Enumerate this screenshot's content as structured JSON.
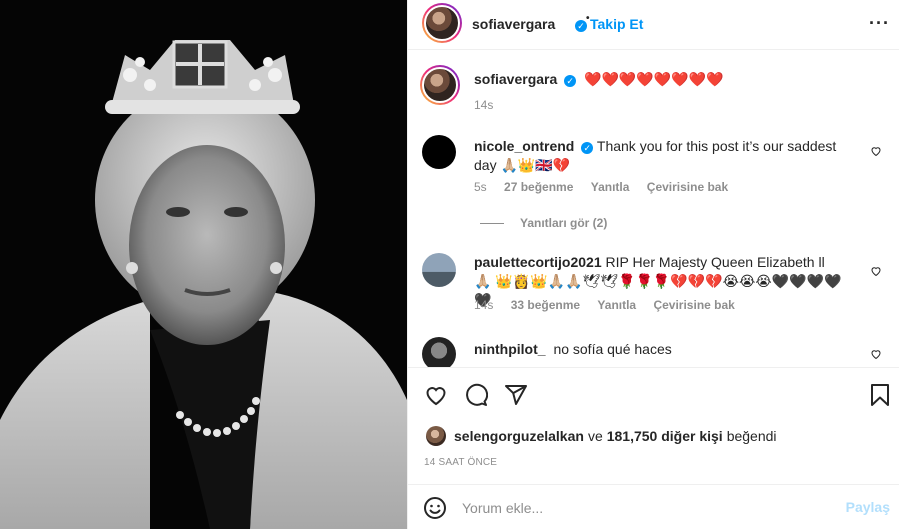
{
  "header": {
    "username": "sofiavergara",
    "verified_mark": "✓",
    "separator": "•",
    "follow_label": "Takip Et",
    "more_label": "···"
  },
  "caption": {
    "username": "sofiavergara",
    "text": "❤️❤️❤️❤️❤️❤️❤️❤️",
    "time": "14s"
  },
  "comments": [
    {
      "username": "nicole_ontrend",
      "verified": true,
      "text": "Thank you for this post it’s our saddest day 🙏🏼👑🇬🇧💔",
      "time": "5s",
      "likes": "27 beğenme",
      "reply": "Yanıtla",
      "translate": "Çevirisine bak",
      "view_replies": "Yanıtları gör (2)"
    },
    {
      "username": "paulettecortijo2021",
      "verified": false,
      "text": "RIP Her Majesty Queen Elizabeth ll 🙏🏼 👑👸👑🙏🏼🙏🏼🕊🕊🌹🌹🌹💔💔💔😭😭😭🖤🖤🖤🖤🖤",
      "time": "14s",
      "likes": "33 beğenme",
      "reply": "Yanıtla",
      "translate": "Çevirisine bak"
    },
    {
      "username": "ninthpilot_",
      "verified": false,
      "text": "no sofía qué haces"
    }
  ],
  "likes": {
    "user": "selengorguzelalkan",
    "connector": "ve",
    "others": "181,750 diğer kişi",
    "suffix": "beğendi"
  },
  "timestamp": "14 SAAT ÖNCE",
  "comment_box": {
    "placeholder": "Yorum ekle...",
    "post_label": "Paylaş"
  },
  "icons": [
    "heart-icon",
    "comment-icon",
    "share-icon",
    "bookmark-icon",
    "emoji-icon",
    "more-options-icon",
    "verified-icon"
  ],
  "colors": {
    "accent": "#0095f6",
    "post_disabled": "#b2dffc",
    "muted": "#8e8e8e",
    "text": "#262626",
    "border": "#efefef"
  }
}
